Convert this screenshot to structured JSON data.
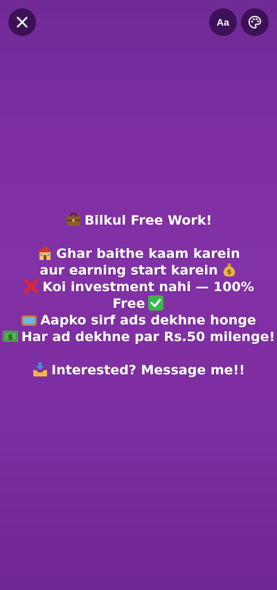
{
  "toolbar": {
    "font_button_label": "Aa",
    "close_icon": "close-icon",
    "palette_icon": "palette-icon"
  },
  "colors": {
    "background_top": "#6f2a96",
    "background_mid": "#8331a6",
    "button_bg": "#3d1157",
    "text": "#ffffff"
  },
  "story": {
    "line1": "Bilkul Free Work!",
    "line2": "Ghar baithe kaam karein",
    "line3": "aur earning start karein",
    "line4": "Koi investment nahi — 100%",
    "line5": "Free",
    "line6": "Aapko sirf ads dekhne honge",
    "line7": "Har ad dekhne par Rs.50 milenge!",
    "line8": "Interested? Message me!!"
  },
  "emojis": [
    "briefcase",
    "house",
    "money-bag",
    "cross-mark",
    "check-mark",
    "television",
    "dollar-banknote",
    "inbox-tray"
  ]
}
